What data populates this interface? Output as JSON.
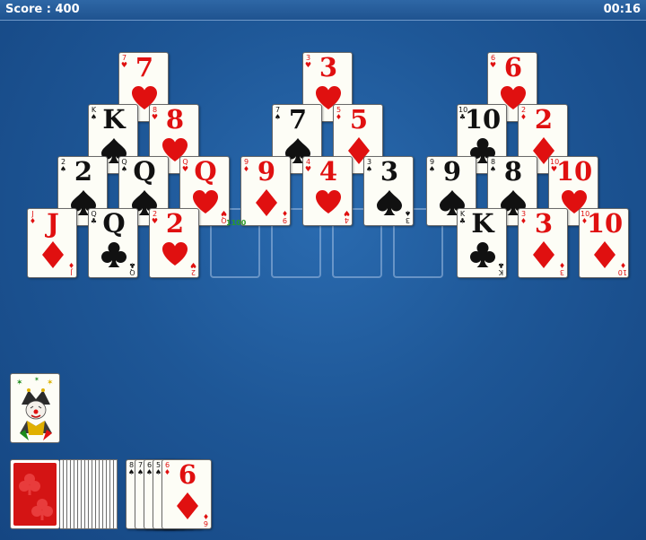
{
  "header": {
    "score_label": "Score : 400",
    "timer": "00:16"
  },
  "side_badge": "1100",
  "colors": {
    "red": "#e01010",
    "black": "#111111",
    "felt": "#1e5797"
  },
  "tableau": [
    {
      "rank": "7",
      "suit": "hearts",
      "color": "red"
    },
    {
      "rank": "3",
      "suit": "hearts",
      "color": "red"
    },
    {
      "rank": "6",
      "suit": "hearts",
      "color": "red"
    },
    {
      "rank": "K",
      "suit": "spades",
      "color": "black"
    },
    {
      "rank": "8",
      "suit": "hearts",
      "color": "red"
    },
    {
      "rank": "7",
      "suit": "spades",
      "color": "black"
    },
    {
      "rank": "5",
      "suit": "diamonds",
      "color": "red"
    },
    {
      "rank": "10",
      "suit": "clubs",
      "color": "black"
    },
    {
      "rank": "2",
      "suit": "diamonds",
      "color": "red"
    },
    {
      "rank": "2",
      "suit": "spades",
      "color": "black"
    },
    {
      "rank": "Q",
      "suit": "spades",
      "color": "black"
    },
    {
      "rank": "Q",
      "suit": "hearts",
      "color": "red"
    },
    {
      "rank": "9",
      "suit": "diamonds",
      "color": "red"
    },
    {
      "rank": "4",
      "suit": "hearts",
      "color": "red"
    },
    {
      "rank": "3",
      "suit": "spades",
      "color": "black"
    },
    {
      "rank": "9",
      "suit": "spades",
      "color": "black"
    },
    {
      "rank": "8",
      "suit": "spades",
      "color": "black"
    },
    {
      "rank": "10",
      "suit": "hearts",
      "color": "red"
    },
    {
      "rank": "J",
      "suit": "diamonds",
      "color": "red"
    },
    {
      "rank": "Q",
      "suit": "clubs",
      "color": "black"
    },
    {
      "rank": "2",
      "suit": "hearts",
      "color": "red"
    },
    {
      "rank": "K",
      "suit": "clubs",
      "color": "black"
    },
    {
      "rank": "3",
      "suit": "diamonds",
      "color": "red"
    },
    {
      "rank": "10",
      "suit": "diamonds",
      "color": "red"
    }
  ],
  "waste": [
    {
      "rank": "8",
      "suit": "spades",
      "color": "black"
    },
    {
      "rank": "7",
      "suit": "spades",
      "color": "black"
    },
    {
      "rank": "6",
      "suit": "spades",
      "color": "black"
    },
    {
      "rank": "5",
      "suit": "spades",
      "color": "black"
    },
    {
      "rank": "6",
      "suit": "diamonds",
      "color": "red"
    }
  ],
  "joker_icon": "joker-icon",
  "stock_back_icon": "card-back-clubs-icon"
}
